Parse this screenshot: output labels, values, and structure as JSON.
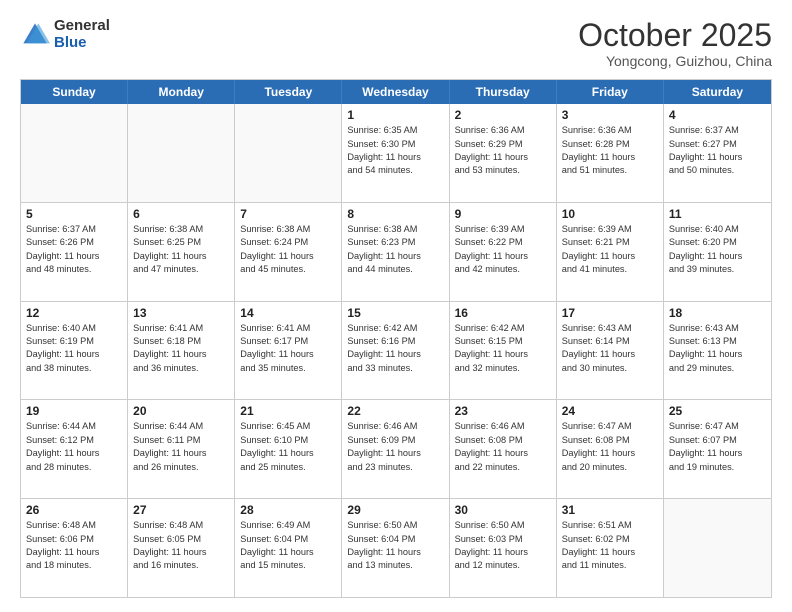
{
  "logo": {
    "general": "General",
    "blue": "Blue"
  },
  "title": "October 2025",
  "subtitle": "Yongcong, Guizhou, China",
  "header_days": [
    "Sunday",
    "Monday",
    "Tuesday",
    "Wednesday",
    "Thursday",
    "Friday",
    "Saturday"
  ],
  "weeks": [
    [
      {
        "day": "",
        "info": ""
      },
      {
        "day": "",
        "info": ""
      },
      {
        "day": "",
        "info": ""
      },
      {
        "day": "1",
        "info": "Sunrise: 6:35 AM\nSunset: 6:30 PM\nDaylight: 11 hours\nand 54 minutes."
      },
      {
        "day": "2",
        "info": "Sunrise: 6:36 AM\nSunset: 6:29 PM\nDaylight: 11 hours\nand 53 minutes."
      },
      {
        "day": "3",
        "info": "Sunrise: 6:36 AM\nSunset: 6:28 PM\nDaylight: 11 hours\nand 51 minutes."
      },
      {
        "day": "4",
        "info": "Sunrise: 6:37 AM\nSunset: 6:27 PM\nDaylight: 11 hours\nand 50 minutes."
      }
    ],
    [
      {
        "day": "5",
        "info": "Sunrise: 6:37 AM\nSunset: 6:26 PM\nDaylight: 11 hours\nand 48 minutes."
      },
      {
        "day": "6",
        "info": "Sunrise: 6:38 AM\nSunset: 6:25 PM\nDaylight: 11 hours\nand 47 minutes."
      },
      {
        "day": "7",
        "info": "Sunrise: 6:38 AM\nSunset: 6:24 PM\nDaylight: 11 hours\nand 45 minutes."
      },
      {
        "day": "8",
        "info": "Sunrise: 6:38 AM\nSunset: 6:23 PM\nDaylight: 11 hours\nand 44 minutes."
      },
      {
        "day": "9",
        "info": "Sunrise: 6:39 AM\nSunset: 6:22 PM\nDaylight: 11 hours\nand 42 minutes."
      },
      {
        "day": "10",
        "info": "Sunrise: 6:39 AM\nSunset: 6:21 PM\nDaylight: 11 hours\nand 41 minutes."
      },
      {
        "day": "11",
        "info": "Sunrise: 6:40 AM\nSunset: 6:20 PM\nDaylight: 11 hours\nand 39 minutes."
      }
    ],
    [
      {
        "day": "12",
        "info": "Sunrise: 6:40 AM\nSunset: 6:19 PM\nDaylight: 11 hours\nand 38 minutes."
      },
      {
        "day": "13",
        "info": "Sunrise: 6:41 AM\nSunset: 6:18 PM\nDaylight: 11 hours\nand 36 minutes."
      },
      {
        "day": "14",
        "info": "Sunrise: 6:41 AM\nSunset: 6:17 PM\nDaylight: 11 hours\nand 35 minutes."
      },
      {
        "day": "15",
        "info": "Sunrise: 6:42 AM\nSunset: 6:16 PM\nDaylight: 11 hours\nand 33 minutes."
      },
      {
        "day": "16",
        "info": "Sunrise: 6:42 AM\nSunset: 6:15 PM\nDaylight: 11 hours\nand 32 minutes."
      },
      {
        "day": "17",
        "info": "Sunrise: 6:43 AM\nSunset: 6:14 PM\nDaylight: 11 hours\nand 30 minutes."
      },
      {
        "day": "18",
        "info": "Sunrise: 6:43 AM\nSunset: 6:13 PM\nDaylight: 11 hours\nand 29 minutes."
      }
    ],
    [
      {
        "day": "19",
        "info": "Sunrise: 6:44 AM\nSunset: 6:12 PM\nDaylight: 11 hours\nand 28 minutes."
      },
      {
        "day": "20",
        "info": "Sunrise: 6:44 AM\nSunset: 6:11 PM\nDaylight: 11 hours\nand 26 minutes."
      },
      {
        "day": "21",
        "info": "Sunrise: 6:45 AM\nSunset: 6:10 PM\nDaylight: 11 hours\nand 25 minutes."
      },
      {
        "day": "22",
        "info": "Sunrise: 6:46 AM\nSunset: 6:09 PM\nDaylight: 11 hours\nand 23 minutes."
      },
      {
        "day": "23",
        "info": "Sunrise: 6:46 AM\nSunset: 6:08 PM\nDaylight: 11 hours\nand 22 minutes."
      },
      {
        "day": "24",
        "info": "Sunrise: 6:47 AM\nSunset: 6:08 PM\nDaylight: 11 hours\nand 20 minutes."
      },
      {
        "day": "25",
        "info": "Sunrise: 6:47 AM\nSunset: 6:07 PM\nDaylight: 11 hours\nand 19 minutes."
      }
    ],
    [
      {
        "day": "26",
        "info": "Sunrise: 6:48 AM\nSunset: 6:06 PM\nDaylight: 11 hours\nand 18 minutes."
      },
      {
        "day": "27",
        "info": "Sunrise: 6:48 AM\nSunset: 6:05 PM\nDaylight: 11 hours\nand 16 minutes."
      },
      {
        "day": "28",
        "info": "Sunrise: 6:49 AM\nSunset: 6:04 PM\nDaylight: 11 hours\nand 15 minutes."
      },
      {
        "day": "29",
        "info": "Sunrise: 6:50 AM\nSunset: 6:04 PM\nDaylight: 11 hours\nand 13 minutes."
      },
      {
        "day": "30",
        "info": "Sunrise: 6:50 AM\nSunset: 6:03 PM\nDaylight: 11 hours\nand 12 minutes."
      },
      {
        "day": "31",
        "info": "Sunrise: 6:51 AM\nSunset: 6:02 PM\nDaylight: 11 hours\nand 11 minutes."
      },
      {
        "day": "",
        "info": ""
      }
    ]
  ]
}
